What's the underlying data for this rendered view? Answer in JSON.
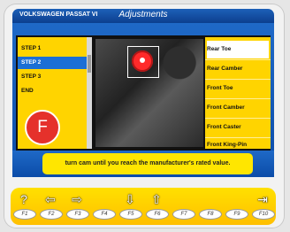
{
  "window": {
    "vehicle": "VOLKSWAGEN PASSAT VI",
    "title": "Adjustments"
  },
  "steps": {
    "items": [
      {
        "label": "STEP 1"
      },
      {
        "label": "STEP 2"
      },
      {
        "label": "STEP 3"
      },
      {
        "label": "END"
      }
    ],
    "badge": "F"
  },
  "menu": {
    "items": [
      {
        "label": "Rear Toe"
      },
      {
        "label": "Rear Camber"
      },
      {
        "label": "Front Toe"
      },
      {
        "label": "Front Camber"
      },
      {
        "label": "Front Caster"
      },
      {
        "label": "Front King-Pin"
      }
    ]
  },
  "message": "turn cam until you reach the manufacturer's rated value.",
  "function_keys": [
    {
      "label": "F1",
      "icon": "help-icon",
      "glyph": "?"
    },
    {
      "label": "F2",
      "icon": "arrow-left-icon",
      "glyph": "⇦"
    },
    {
      "label": "F3",
      "icon": "arrow-right-icon",
      "glyph": "⇨"
    },
    {
      "label": "F4",
      "icon": "",
      "glyph": ""
    },
    {
      "label": "F5",
      "icon": "list-down-icon",
      "glyph": "⇩"
    },
    {
      "label": "F6",
      "icon": "list-up-icon",
      "glyph": "⇧"
    },
    {
      "label": "F7",
      "icon": "",
      "glyph": ""
    },
    {
      "label": "F8",
      "icon": "",
      "glyph": ""
    },
    {
      "label": "F9",
      "icon": "",
      "glyph": ""
    },
    {
      "label": "F10",
      "icon": "exit-icon",
      "glyph": "⇥"
    }
  ],
  "colors": {
    "accent_blue": "#1b6fd5",
    "panel_yellow": "#ffd400",
    "badge_red": "#e5312b"
  }
}
